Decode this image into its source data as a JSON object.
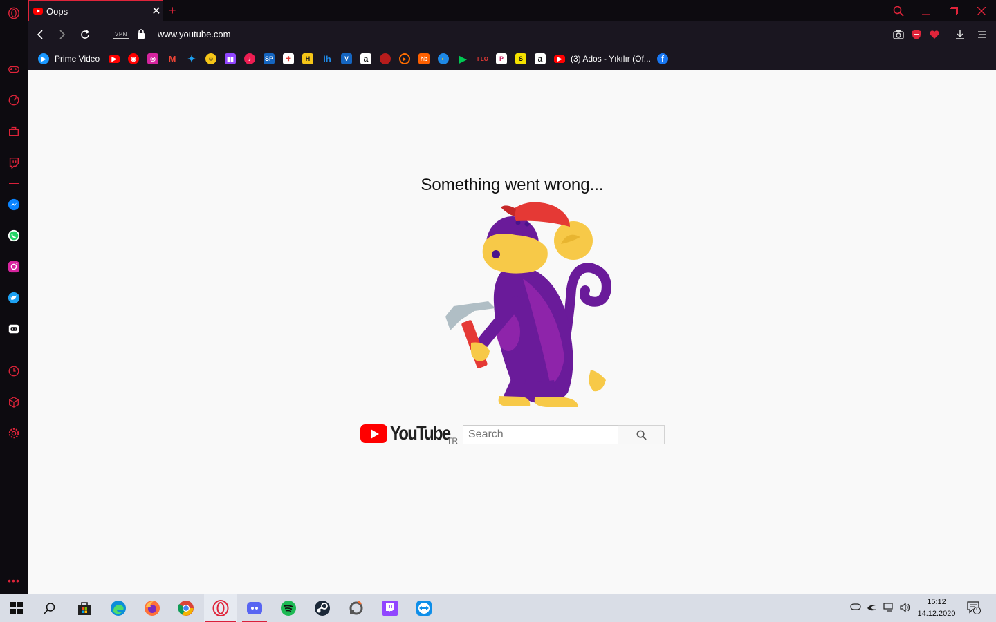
{
  "browser": {
    "tab": {
      "title": "Oops",
      "close": "✕"
    },
    "new_tab": "+",
    "vpn_badge": "VPN",
    "url": "www.youtube.com"
  },
  "bookmarks": {
    "items": [
      {
        "label": "Prime Video",
        "icon": "prime-video-icon",
        "color": "#1a98ff"
      },
      {
        "label": "",
        "icon": "youtube-icon",
        "color": "#ff0000"
      },
      {
        "label": "",
        "icon": "youtube-music-icon",
        "color": "#ff0000"
      },
      {
        "label": "",
        "icon": "instagram-icon",
        "color": "#d6249f"
      },
      {
        "label": "",
        "icon": "gmail-icon",
        "color": "#ea4335"
      },
      {
        "label": "",
        "icon": "twitter-icon",
        "color": "#1da1f2"
      },
      {
        "label": "",
        "icon": "emoji-icon",
        "color": "#f5c518"
      },
      {
        "label": "",
        "icon": "twitch-icon",
        "color": "#9146ff"
      },
      {
        "label": "",
        "icon": "tiktok-icon",
        "color": "#ee1d52"
      },
      {
        "label": "SP",
        "icon": "sp-icon",
        "color": "#1565c0"
      },
      {
        "label": "",
        "icon": "news-icon",
        "color": "#e53935"
      },
      {
        "label": "",
        "icon": "hurriyet-icon",
        "color": "#f5c518"
      },
      {
        "label": "ih",
        "icon": "ih-icon",
        "color": "#1e88e5"
      },
      {
        "label": "V",
        "icon": "v-icon",
        "color": "#1565c0"
      },
      {
        "label": "a",
        "icon": "amazon-icon",
        "color": "#ffffff"
      },
      {
        "label": "",
        "icon": "red-circle-icon",
        "color": "#b71c1c"
      },
      {
        "label": "",
        "icon": "orange-ring-icon",
        "color": "#ff6d00"
      },
      {
        "label": "hb",
        "icon": "hepsiburada-icon",
        "color": "#ff6000"
      },
      {
        "label": "",
        "icon": "globe-icon",
        "color": "#1e88e5"
      },
      {
        "label": "",
        "icon": "play-store-icon",
        "color": "#00c853"
      },
      {
        "label": "FLO",
        "icon": "flo-icon",
        "color": "#e53935"
      },
      {
        "label": "P",
        "icon": "p-icon",
        "color": "#ffffff"
      },
      {
        "label": "S",
        "icon": "s-icon",
        "color": "#f5e100"
      },
      {
        "label": "a",
        "icon": "amazon-icon",
        "color": "#ffffff"
      },
      {
        "label": "(3) Ados - Yıkılır (Of...",
        "icon": "youtube-icon",
        "color": "#ff0000"
      },
      {
        "label": "",
        "icon": "facebook-icon",
        "color": "#1877f2"
      }
    ]
  },
  "page": {
    "error_title": "Something went wrong...",
    "logo_word": "YouTube",
    "logo_region": "TR",
    "search_placeholder": "Search"
  },
  "taskbar": {
    "time": "15:12",
    "date": "14.12.2020",
    "notification_count": "1"
  },
  "colors": {
    "opera_red": "#e0243a",
    "youtube_red": "#ff0000",
    "monkey_purple": "#6a1b9a",
    "monkey_yellow": "#f7c948",
    "page_bg": "#f9f9f9"
  }
}
